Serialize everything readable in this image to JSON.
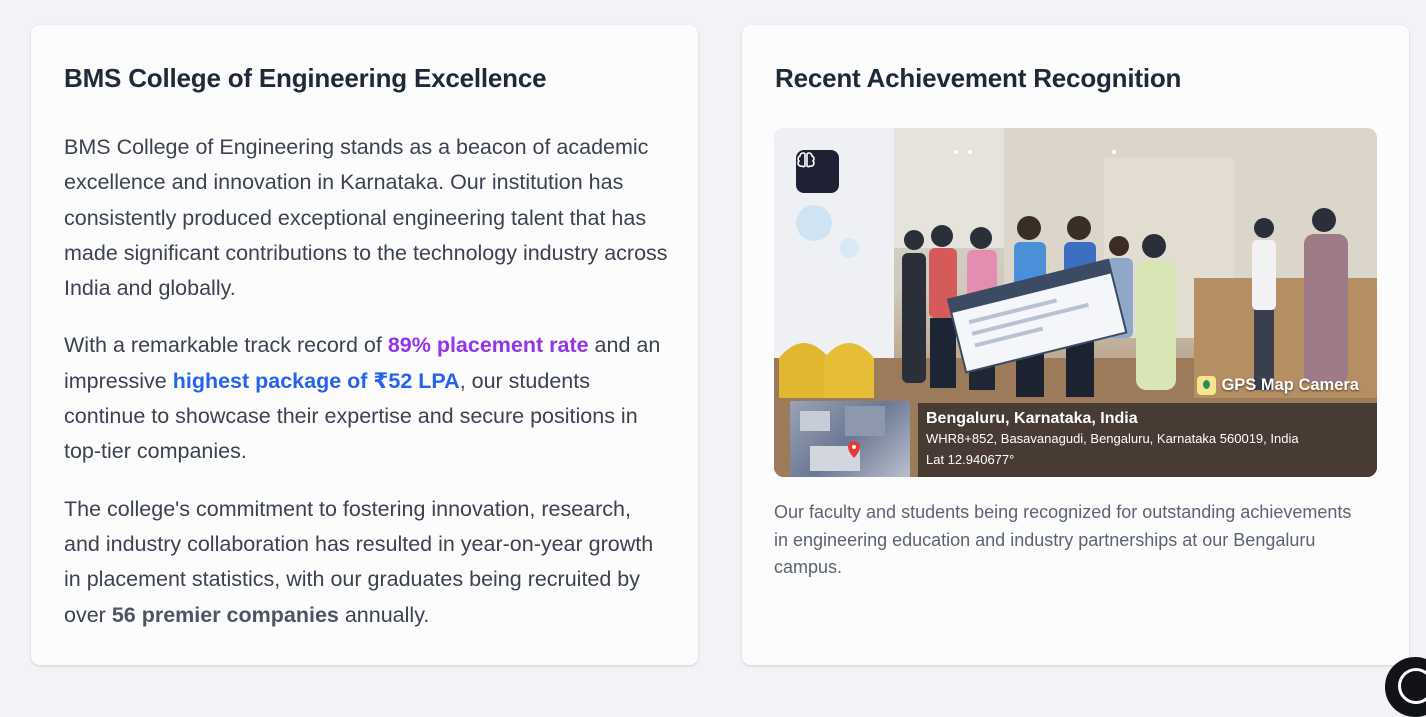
{
  "left_card": {
    "title": "BMS College of Engineering Excellence",
    "p1": "BMS College of Engineering stands as a beacon of academic excellence and innovation in Karnataka. Our institution has consistently produced exceptional engineering talent that has made significant contributions to the technology industry across India and globally.",
    "p2_before": "With a remarkable track record of ",
    "p2_highlight_1": "89% placement rate",
    "p2_middle": " and an impressive ",
    "p2_highlight_2": "highest package of ₹52 LPA",
    "p2_after": ", our students continue to showcase their expertise and secure positions in top-tier companies.",
    "p3_before": "The college's commitment to fostering innovation, research, and industry collaboration has resulted in year-on-year growth in placement statistics, with our graduates being recruited by over ",
    "p3_strong": "56 premier companies",
    "p3_after": " annually.",
    "highlight_colors": {
      "placement_rate": "#9333ea",
      "package": "#2563eb"
    }
  },
  "right_card": {
    "title": "Recent Achievement Recognition",
    "photo": {
      "badge_icon": "brain-icon",
      "gps_camera_label": "GPS Map Camera",
      "gps_city": "Bengaluru, Karnataka, India",
      "gps_address": "WHR8+852, Basavanagudi, Bengaluru, Karnataka 560019, India",
      "gps_lat": "Lat 12.940677°"
    },
    "caption": "Our faculty and students being recognized for outstanding achievements in engineering education and industry partnerships at our Bengaluru campus."
  },
  "colors": {
    "page_background": "#f1f3f6",
    "card_background": "#fcfcfd",
    "title_text": "#1f2937",
    "body_text": "#3b4250"
  }
}
